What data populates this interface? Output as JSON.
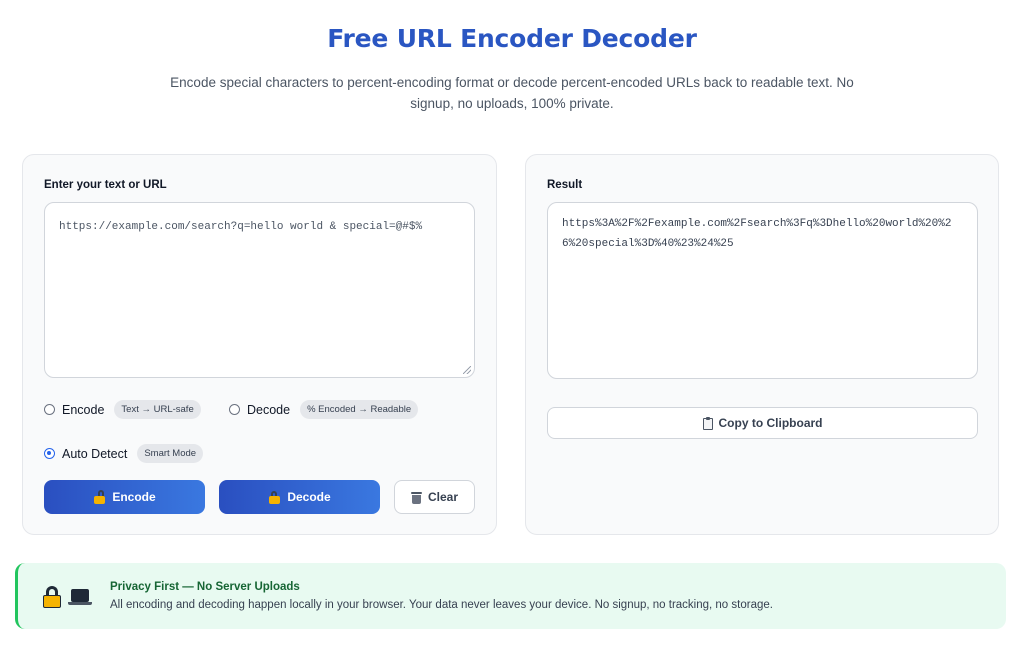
{
  "header": {
    "title": "Free URL Encoder Decoder",
    "subtitle": "Encode special characters to percent-encoding format or decode percent-encoded URLs back to readable text. No signup, no uploads, 100% private."
  },
  "input_panel": {
    "label": "Enter your text or URL",
    "value": "https://example.com/search?q=hello world & special=@#$%",
    "options": [
      {
        "label": "Encode",
        "pill": "Text → URL-safe",
        "selected": false
      },
      {
        "label": "Decode",
        "pill": "% Encoded → Readable",
        "selected": false
      },
      {
        "label": "Auto Detect",
        "pill": "Smart Mode",
        "selected": true
      }
    ],
    "buttons": {
      "encode": "Encode",
      "decode": "Decode",
      "clear": "Clear"
    }
  },
  "result_panel": {
    "label": "Result",
    "value": "https%3A%2F%2Fexample.com%2Fsearch%3Fq%3Dhello%20world%20%26%20special%3D%40%23%24%25",
    "copy_label": "Copy to Clipboard"
  },
  "privacy": {
    "title": "Privacy First — No Server Uploads",
    "text": "All encoding and decoding happen locally in your browser. Your data never leaves your device. No signup, no tracking, no storage.",
    "icons": [
      "lock-icon",
      "laptop-icon"
    ]
  },
  "colors": {
    "title": "#2a56c2",
    "primary_button_start": "#2a4fc0",
    "primary_button_end": "#3a78e0",
    "privacy_bg": "#e8faf1",
    "privacy_accent": "#22c55e",
    "radio_selected": "#2563eb"
  }
}
